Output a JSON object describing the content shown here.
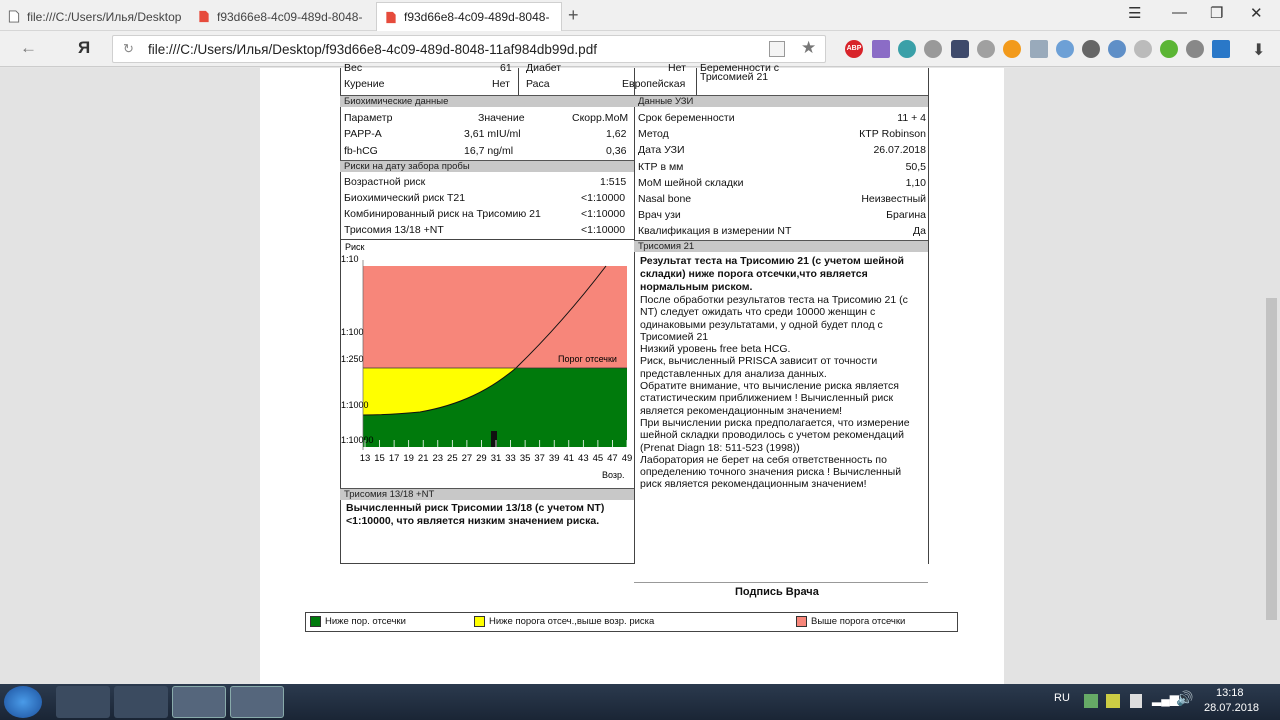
{
  "browser": {
    "tabs": [
      {
        "title": "file:///C:/Users/Илья/Desktop",
        "icon": "document-icon"
      },
      {
        "title": "f93d66e8-4c09-489d-8048-",
        "icon": "pdf-icon"
      },
      {
        "title": "f93d66e8-4c09-489d-8048-",
        "icon": "pdf-icon"
      }
    ],
    "new_tab": "+",
    "url": "file:///C:/Users/Илья/Desktop/f93d66e8-4c09-489d-8048-11af984db99d.pdf",
    "yandex_logo": "Я",
    "ext_abp": "ABP"
  },
  "report": {
    "top": {
      "ves": "Вес",
      "ves_val": "61",
      "diabet": "Диабет",
      "diabet_val": "Нет",
      "kurenie": "Курение",
      "kurenie_val": "Нет",
      "rasa": "Раса",
      "rasa_val": "Европейская",
      "prev_head": "Беременности с",
      "prev_val": "Трисомией 21"
    },
    "bio": {
      "header": "Биохимические данные",
      "col_param": "Параметр",
      "col_value": "Значение",
      "col_mom": "Скорр.МоМ",
      "rows": [
        {
          "p": "PAPP-A",
          "v": "3,61 mIU/ml",
          "m": "1,62"
        },
        {
          "p": "fb-hCG",
          "v": "16,7 ng/ml",
          "m": "0,36"
        }
      ]
    },
    "uzi": {
      "header": "Данные УЗИ",
      "rows": [
        {
          "k": "Срок беременности",
          "v": "11 + 4"
        },
        {
          "k": "Метод",
          "v": "КТР Robinson"
        },
        {
          "k": "Дата УЗИ",
          "v": "26.07.2018"
        },
        {
          "k": "КТР в мм",
          "v": "50,5"
        },
        {
          "k": "МоМ шейной складки",
          "v": "1,10"
        },
        {
          "k": "Nasal bone",
          "v": "Неизвестный"
        },
        {
          "k": "Врач узи",
          "v": "Брагина"
        },
        {
          "k": "Квалификация в измерении NT",
          "v": "Да"
        }
      ]
    },
    "risks": {
      "header": "Риски на дату забора пробы",
      "rows": [
        {
          "k": "Возрастной риск",
          "v": "1:515"
        },
        {
          "k": "Биохимический риск Т21",
          "v": "<1:10000"
        },
        {
          "k": "Комбинированный риск на Трисомию 21",
          "v": "<1:10000"
        },
        {
          "k": "Трисомия 13/18 +NT",
          "v": "<1:10000"
        }
      ]
    },
    "t21": {
      "header": "Трисомия 21",
      "bold": "Результат теста на Трисомию 21 (с учетом шейной складки) ниже порога отсечки,что является нормальным риском.",
      "lines": [
        "После обработки результатов теста на Трисомию 21 (с",
        "NT) следует ожидать что среди 10000 женщин с",
        "одинаковыми результатами, у одной будет плод с",
        "Трисомией 21",
        "Низкий уровень free beta HCG.",
        "Риск, вычисленный PRISCA зависит от точности",
        "представленных для анализа данных.",
        "Обратите внимание, что вычисление риска является",
        "статистическим приближением ! Вычисленный риск",
        "является рекомендационным значением!",
        "При вычислении риска предполагается, что измерение",
        "шейной складки проводилось с учетом рекомендаций",
        "(Prenat Diagn 18: 511-523 (1998))",
        "Лаборатория не берет на себя ответственность по",
        "определению точного значения риска ! Вычисленный",
        "риск является рекомендационным значением!"
      ]
    },
    "t1318": {
      "header": "Трисомия 13/18 +NT",
      "line1": "Вычисленный риск Трисомии 13/18 (с учетом NT)",
      "line2": "<1:10000, что является низким значением риска."
    },
    "signature": "Подпись Врача",
    "legend": {
      "green": "Ниже пор. отсечки",
      "yellow": "Ниже порога отсеч.,выше возр. риска",
      "red": "Выше порога отсечки",
      "c_green": "#007a0c",
      "c_yellow": "#ffff00",
      "c_red": "#f7867a"
    }
  },
  "chart_data": {
    "type": "area",
    "ylabel": "Риск",
    "xlabel": "Возр.",
    "y_ticks": [
      "1:10",
      "1:100",
      "1:250",
      "1:1000",
      "1:10000"
    ],
    "x_ticks": [
      "13",
      "15",
      "17",
      "19",
      "21",
      "23",
      "25",
      "27",
      "29",
      "31",
      "33",
      "35",
      "37",
      "39",
      "41",
      "43",
      "45",
      "47",
      "49"
    ],
    "cutoff_label": "Порог отсечки",
    "cutoff": "1:250",
    "patient": {
      "age": 31,
      "risk": "<1:10000"
    }
  },
  "taskbar": {
    "lang": "RU",
    "time": "13:18",
    "date": "28.07.2018"
  }
}
